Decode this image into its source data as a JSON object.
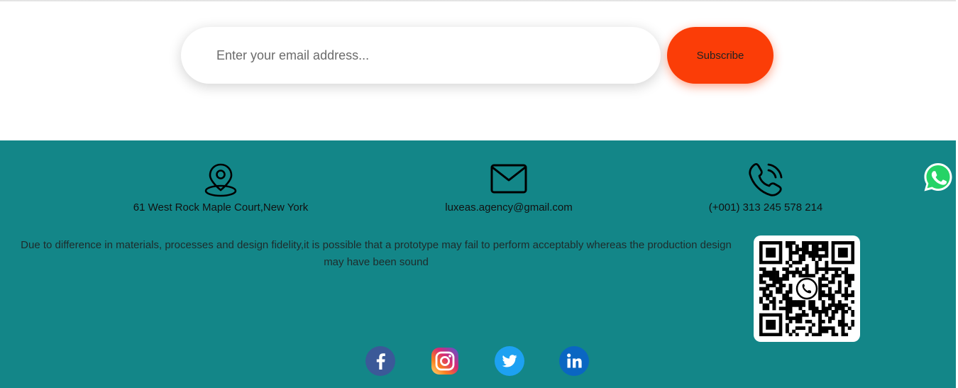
{
  "newsletter": {
    "email_placeholder": "Enter your email address...",
    "subscribe_label": "Subscribe"
  },
  "contact": {
    "address": "61 West Rock Maple Court,New York",
    "email": "luxeas.agency@gmail.com",
    "phone": "(+001) 313 245 578 214",
    "icons": [
      "location-pin-icon",
      "envelope-icon",
      "phone-icon"
    ]
  },
  "disclaimer": "Due to difference in materials, processes and design fidelity,it is possible that a prototype may fail to perform acceptably whereas the production design may have been sound",
  "social": [
    {
      "name": "facebook",
      "icon": "facebook-icon",
      "color": "#3b5998"
    },
    {
      "name": "instagram",
      "icon": "instagram-icon",
      "color": "#d62976"
    },
    {
      "name": "twitter",
      "icon": "twitter-icon",
      "color": "#1da1f2"
    },
    {
      "name": "linkedin",
      "icon": "linkedin-icon",
      "color": "#0a66c2"
    }
  ],
  "qr": {
    "icon": "whatsapp-qr-code"
  },
  "floating": {
    "icon": "whatsapp-icon",
    "color": "#25d366"
  },
  "colors": {
    "footer_bg": "#138688",
    "accent": "#fb3d07"
  }
}
